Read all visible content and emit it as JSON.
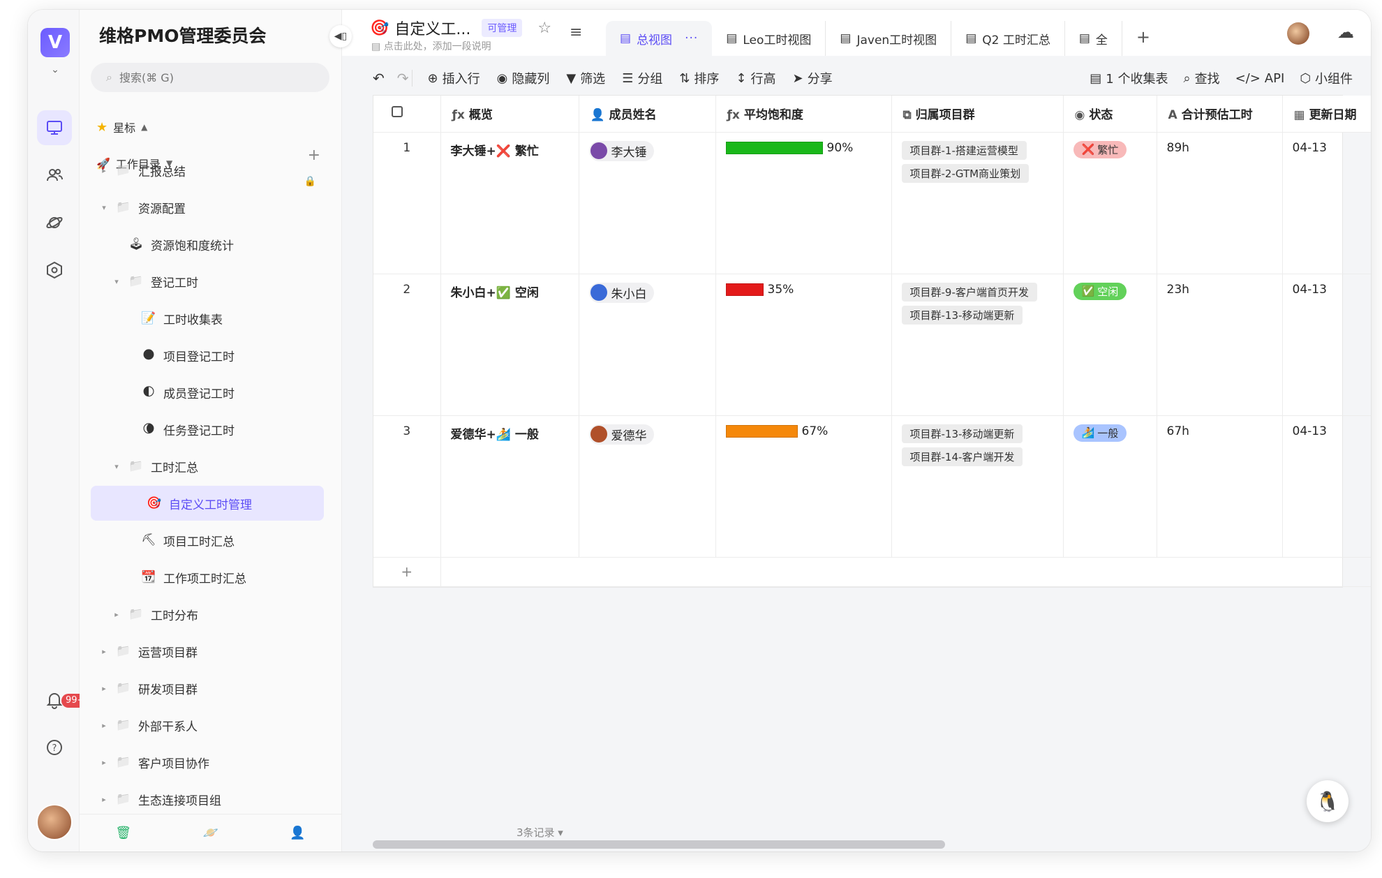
{
  "workspace": {
    "title": "维格PMO管理委员会",
    "search_placeholder": "搜索(⌘ G)",
    "starred_label": "星标",
    "catalog_label": "工作目录",
    "notification_count": "99+"
  },
  "tree": [
    {
      "label": "汇报总结",
      "level": 0,
      "icon": "folder-icon",
      "arrow": "▸",
      "locked": true
    },
    {
      "label": "资源配置",
      "level": 0,
      "icon": "folder-icon",
      "arrow": "▾"
    },
    {
      "label": "资源饱和度统计",
      "level": 1,
      "icon": "joystick-icon",
      "arrow": ""
    },
    {
      "label": "登记工时",
      "level": 1,
      "icon": "folder-icon",
      "arrow": "▾"
    },
    {
      "label": "工时收集表",
      "level": 2,
      "icon": "form-icon",
      "arrow": ""
    },
    {
      "label": "项目登记工时",
      "level": 2,
      "icon": "new-moon-icon",
      "arrow": ""
    },
    {
      "label": "成员登记工时",
      "level": 2,
      "icon": "half-moon-icon",
      "arrow": ""
    },
    {
      "label": "任务登记工时",
      "level": 2,
      "icon": "crescent-moon-icon",
      "arrow": ""
    },
    {
      "label": "工时汇总",
      "level": 1,
      "icon": "folder-icon",
      "arrow": "▾"
    },
    {
      "label": "自定义工时管理",
      "level": 2,
      "icon": "target-icon",
      "arrow": "",
      "active": true
    },
    {
      "label": "项目工时汇总",
      "level": 2,
      "icon": "pickaxe-icon",
      "arrow": ""
    },
    {
      "label": "工作项工时汇总",
      "level": 2,
      "icon": "calendar-icon",
      "arrow": ""
    },
    {
      "label": "工时分布",
      "level": 1,
      "icon": "folder-icon",
      "arrow": "▸"
    },
    {
      "label": "运营项目群",
      "level": 0,
      "icon": "folder-icon",
      "arrow": "▸"
    },
    {
      "label": "研发项目群",
      "level": 0,
      "icon": "folder-icon",
      "arrow": "▸"
    },
    {
      "label": "外部干系人",
      "level": 0,
      "icon": "folder-icon",
      "arrow": "▸"
    },
    {
      "label": "客户项目协作",
      "level": 0,
      "icon": "folder-icon",
      "arrow": "▸"
    },
    {
      "label": "生态连接项目组",
      "level": 0,
      "icon": "folder-icon",
      "arrow": "▸"
    }
  ],
  "doc": {
    "title": "自定义工...",
    "permission": "可管理",
    "description": "点击此处，添加一段说明"
  },
  "tabs": [
    {
      "label": "总视图",
      "active": true
    },
    {
      "label": "Leo工时视图"
    },
    {
      "label": "Javen工时视图"
    },
    {
      "label": "Q2 工时汇总"
    },
    {
      "label": "全"
    }
  ],
  "toolbar": {
    "insert_row": "插入行",
    "hide_column": "隐藏列",
    "filter": "筛选",
    "group": "分组",
    "sort": "排序",
    "row_height": "行高",
    "share": "分享",
    "forms": "1 个收集表",
    "find": "查找",
    "api": "API",
    "widget": "小组件"
  },
  "columns": [
    "概览",
    "成员姓名",
    "平均饱和度",
    "归属项目群",
    "状态",
    "合计预估工时",
    "更新日期"
  ],
  "rows": [
    {
      "num": "1",
      "overview": "李大锤+❌ 繁忙",
      "member": "李大锤",
      "saturation": 0.9,
      "saturation_label": "90%",
      "bar_color": "#1ab81a",
      "projects": [
        "项目群-1-搭建运营模型",
        "项目群-2-GTM商业策划"
      ],
      "status": "繁忙",
      "status_icon": "❌",
      "status_bg": "#f8b9b9",
      "hours": "89h",
      "date": "04-13"
    },
    {
      "num": "2",
      "overview": "朱小白+✅ 空闲",
      "member": "朱小白",
      "saturation": 0.35,
      "saturation_label": "35%",
      "bar_color": "#e31a1a",
      "projects": [
        "项目群-9-客户端首页开发",
        "项目群-13-移动端更新"
      ],
      "status": "空闲",
      "status_icon": "✅",
      "status_bg": "#62d15a",
      "hours": "23h",
      "date": "04-13"
    },
    {
      "num": "3",
      "overview": "爱德华+🏄 一般",
      "member": "爱德华",
      "saturation": 0.67,
      "saturation_label": "67%",
      "bar_color": "#f5880a",
      "projects": [
        "项目群-13-移动端更新",
        "项目群-14-客户端开发"
      ],
      "status": "一般",
      "status_icon": "🏄",
      "status_bg": "#a9c4ff",
      "hours": "67h",
      "date": "04-13"
    }
  ],
  "footer": {
    "record_count": "3条记录 ▾"
  }
}
